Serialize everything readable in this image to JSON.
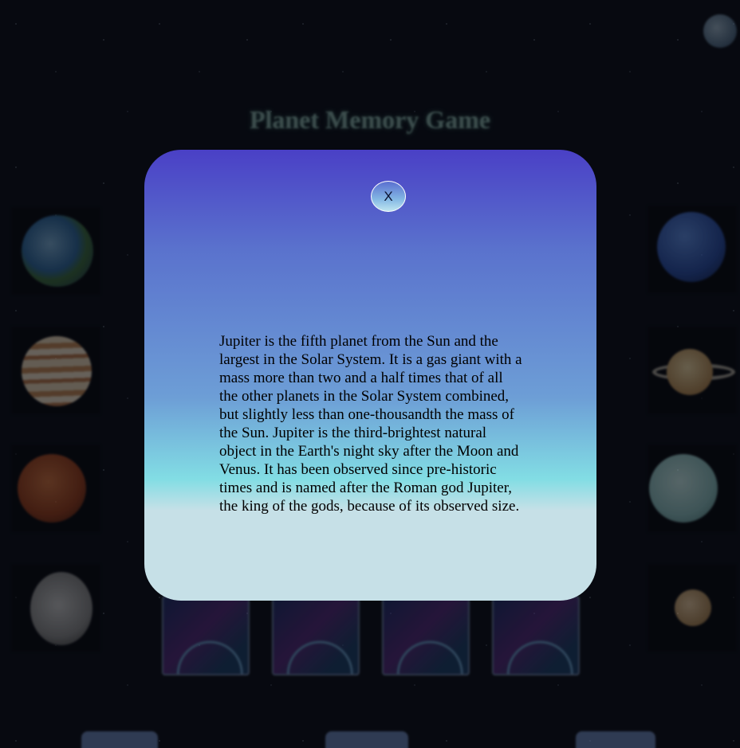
{
  "game": {
    "title": "Planet Memory Game"
  },
  "modal": {
    "close_label": "X",
    "description": "Jupiter is the fifth planet from the Sun and the largest in the Solar System. It is a gas giant with a mass more than two and a half times that of all the other planets in the Solar System combined, but slightly less than one-thousandth the mass of the Sun. Jupiter is the third-brightest natural object in the Earth's night sky after the Moon and Venus. It has been observed since pre-historic times and is named after the Roman god Jupiter, the king of the gods, because of its observed size."
  },
  "planet_tiles": {
    "left": [
      "earth-icon",
      "jupiter-icon",
      "mars-icon",
      "mercury-icon"
    ],
    "right": [
      "neptune-icon",
      "saturn-icon",
      "uranus-icon",
      "venus-icon"
    ]
  },
  "colors": {
    "modal_top": "#4a40c6",
    "modal_mid": "#6d9ed6",
    "modal_cyan": "#82dde4",
    "modal_bottom": "#c6e0e7",
    "background": "#0a0d16"
  }
}
